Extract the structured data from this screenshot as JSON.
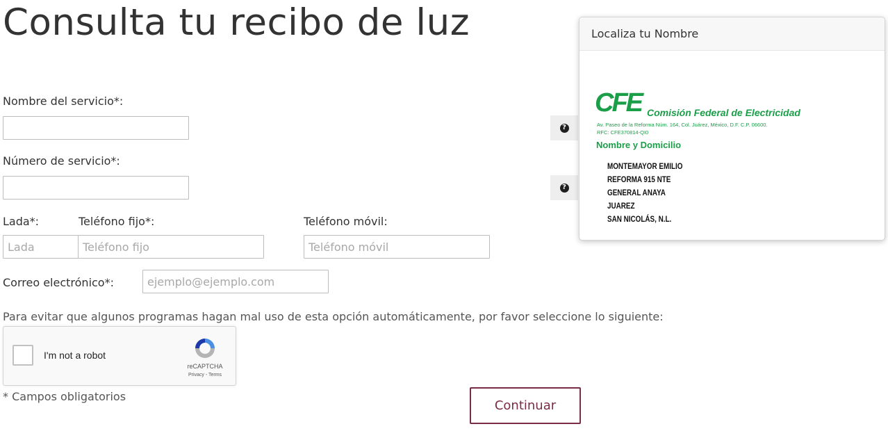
{
  "page": {
    "title": "Consulta tu recibo de luz"
  },
  "form": {
    "service_name_label": "Nombre del servicio*:",
    "service_number_label": "Número de servicio*:",
    "lada_label": "Lada*:",
    "lada_placeholder": "Lada",
    "phone_label": "Teléfono fijo*:",
    "phone_placeholder": "Teléfono fijo",
    "mobile_label": "Teléfono móvil:",
    "mobile_placeholder": "Teléfono móvil",
    "email_label": "Correo electrónico*:",
    "email_placeholder": "ejemplo@ejemplo.com",
    "captcha_note": "Para evitar que algunos programas hagan mal uso de esta opción automáticamente, por favor seleccione lo siguiente:",
    "required_note": "* Campos obligatorios",
    "continue_label": "Continuar"
  },
  "captcha": {
    "label": "I'm not a robot",
    "brand": "reCAPTCHA",
    "links": "Privacy - Terms"
  },
  "popover": {
    "title": "Localiza tu Nombre",
    "logo_text": "CFE",
    "org_name": "Comisión Federal de Electricidad",
    "address": "Av. Paseo de la Reforma Núm. 164, Col. Juárez, México, D.F. C.P. 06600.",
    "rfc": "RFC: CFE370814-QI0",
    "section_label": "Nombre y Domicilio",
    "lines": [
      "MONTEMAYOR EMILIO",
      "REFORMA 915 NTE",
      "GENERAL ANAYA",
      "JUAREZ",
      "SAN NICOLÁS, N.L."
    ]
  },
  "help": {
    "glyph": "?"
  },
  "colors": {
    "brand_green": "#1a9e48",
    "button_accent": "#7a2c46",
    "text": "#333333"
  }
}
